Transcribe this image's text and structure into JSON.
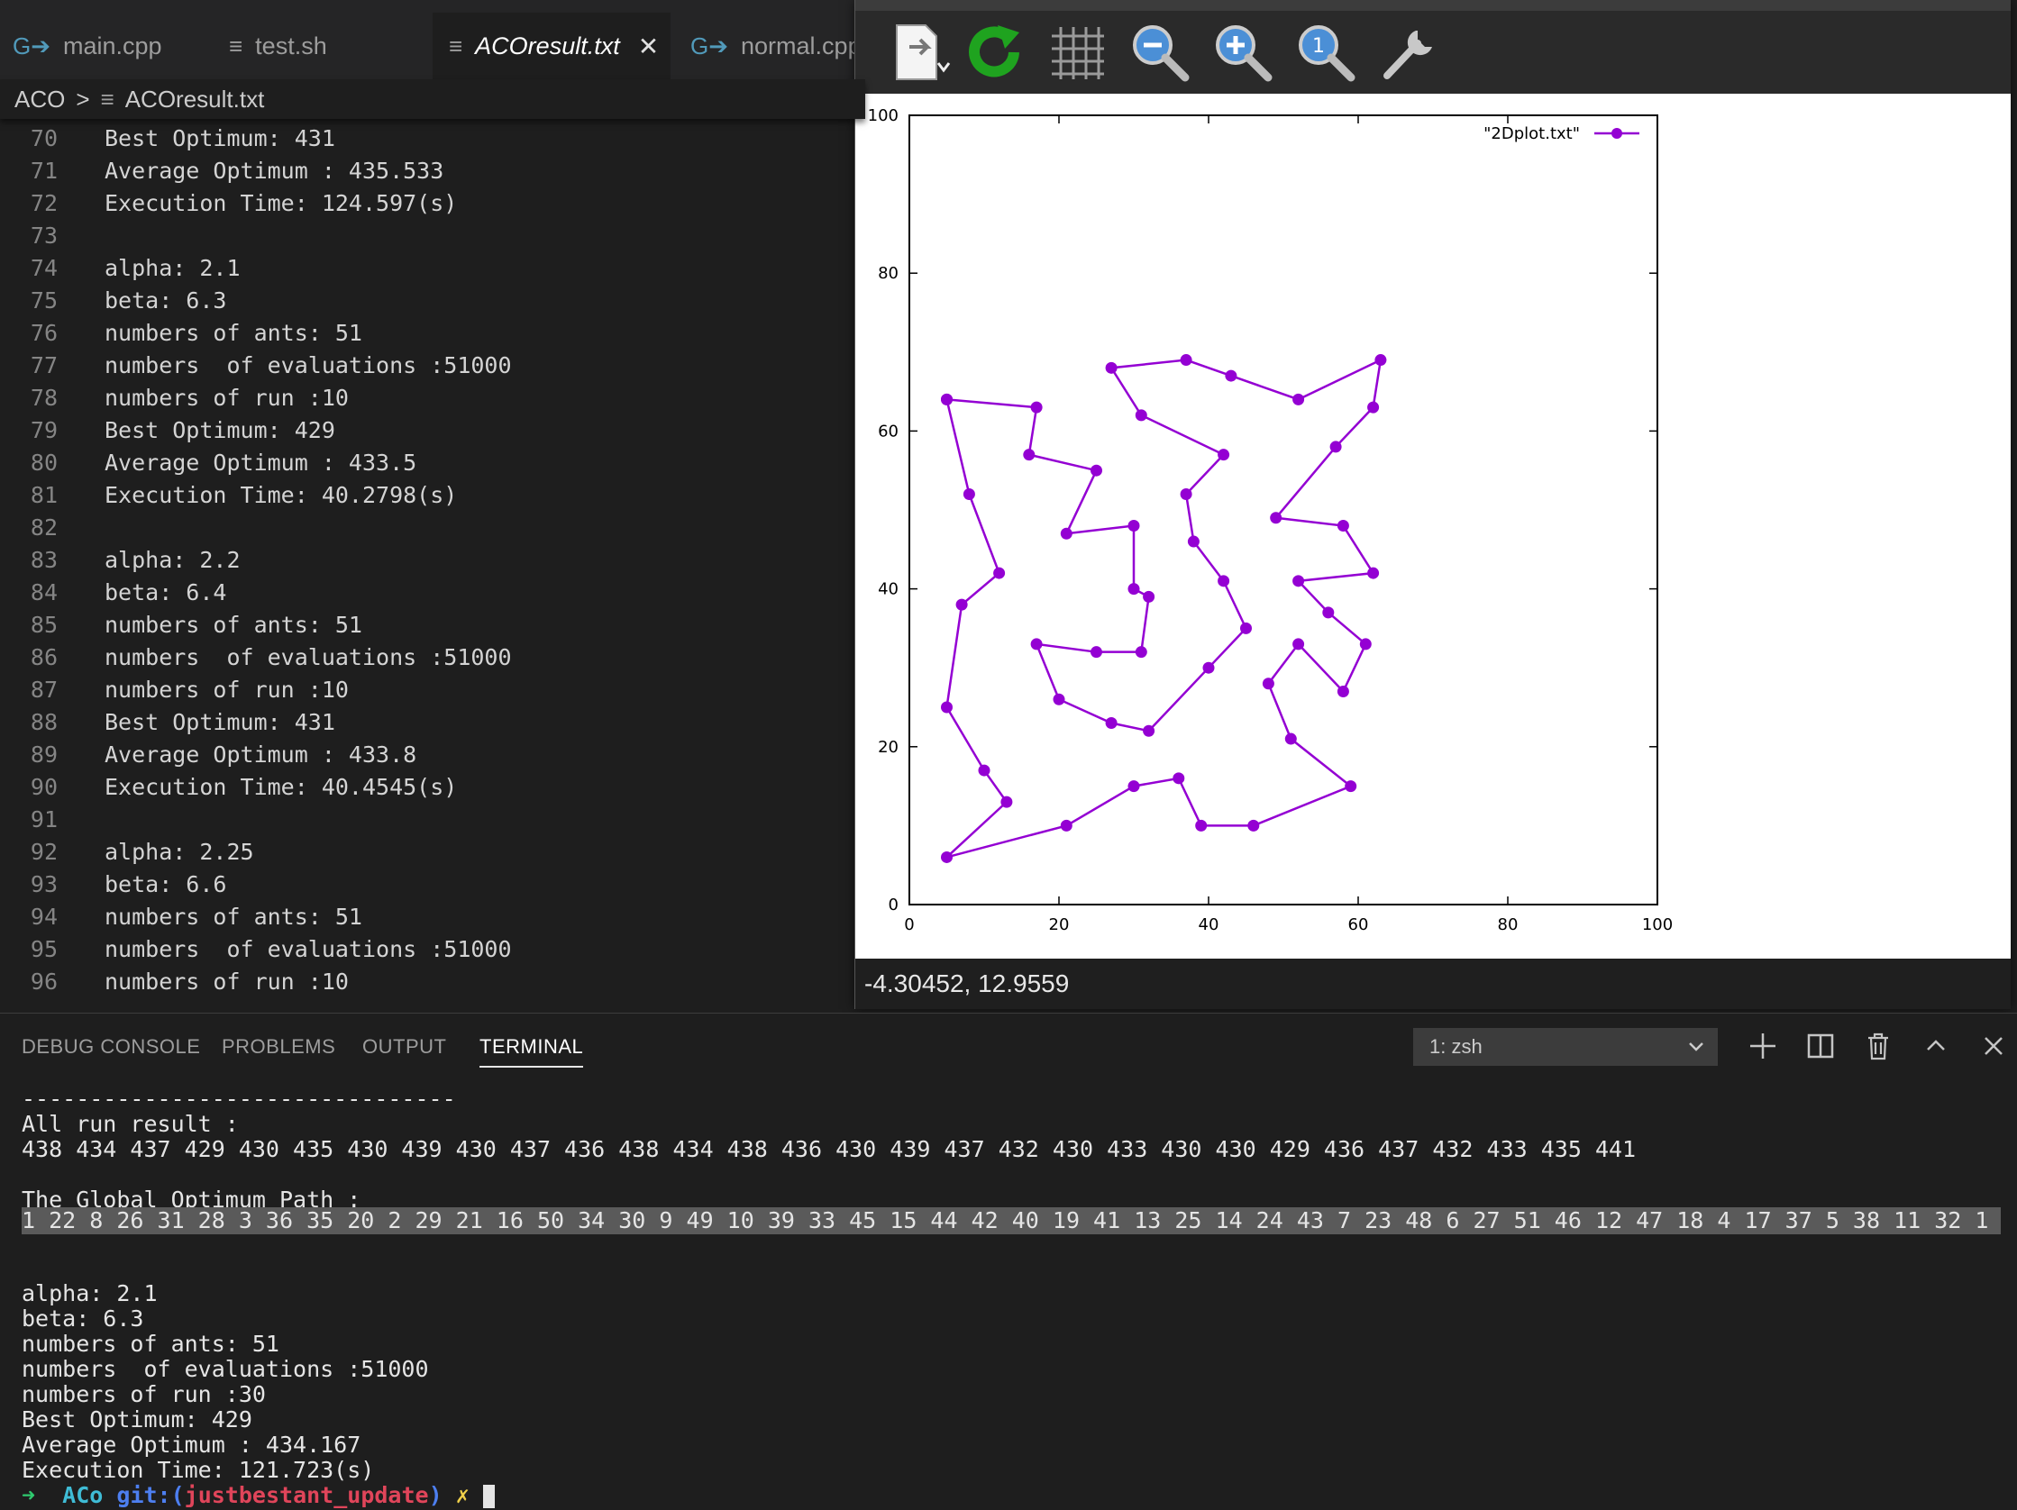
{
  "tabs": [
    {
      "label": "main.cpp",
      "icon": "cpp-file-icon",
      "active": false
    },
    {
      "label": "test.sh",
      "icon": "text-file-icon",
      "active": false
    },
    {
      "label": "ACOresult.txt",
      "icon": "text-file-icon",
      "active": true
    },
    {
      "label": "normal.cpp",
      "icon": "cpp-file-icon",
      "active": false
    }
  ],
  "breadcrumb": {
    "folder": "ACO",
    "separator": ">",
    "file": "ACOresult.txt"
  },
  "editor": {
    "lines": [
      {
        "num": "70",
        "text": "Best Optimum: 431"
      },
      {
        "num": "71",
        "text": "Average Optimum : 435.533"
      },
      {
        "num": "72",
        "text": "Execution Time: 124.597(s)"
      },
      {
        "num": "73",
        "text": ""
      },
      {
        "num": "74",
        "text": "alpha: 2.1"
      },
      {
        "num": "75",
        "text": "beta: 6.3"
      },
      {
        "num": "76",
        "text": "numbers of ants: 51"
      },
      {
        "num": "77",
        "text": "numbers  of evaluations :51000"
      },
      {
        "num": "78",
        "text": "numbers of run :10"
      },
      {
        "num": "79",
        "text": "Best Optimum: 429"
      },
      {
        "num": "80",
        "text": "Average Optimum : 433.5"
      },
      {
        "num": "81",
        "text": "Execution Time: 40.2798(s)"
      },
      {
        "num": "82",
        "text": ""
      },
      {
        "num": "83",
        "text": "alpha: 2.2"
      },
      {
        "num": "84",
        "text": "beta: 6.4"
      },
      {
        "num": "85",
        "text": "numbers of ants: 51"
      },
      {
        "num": "86",
        "text": "numbers  of evaluations :51000"
      },
      {
        "num": "87",
        "text": "numbers of run :10"
      },
      {
        "num": "88",
        "text": "Best Optimum: 431"
      },
      {
        "num": "89",
        "text": "Average Optimum : 433.8"
      },
      {
        "num": "90",
        "text": "Execution Time: 40.4545(s)"
      },
      {
        "num": "91",
        "text": ""
      },
      {
        "num": "92",
        "text": "alpha: 2.25"
      },
      {
        "num": "93",
        "text": "beta: 6.6"
      },
      {
        "num": "94",
        "text": "numbers of ants: 51"
      },
      {
        "num": "95",
        "text": "numbers  of evaluations :51000"
      },
      {
        "num": "96",
        "text": "numbers of run :10"
      }
    ]
  },
  "gnuplot": {
    "toolbar_icons": [
      "export-icon",
      "replot-icon",
      "grid-icon",
      "zoom-out-icon",
      "zoom-in-icon",
      "zoom-reset-icon",
      "settings-wrench-icon"
    ],
    "status": "-4.30452,  12.9559",
    "accent_color": "#9400d3"
  },
  "chart_data": {
    "type": "line",
    "title": "",
    "xlabel": "",
    "ylabel": "",
    "xlim": [
      0,
      100
    ],
    "ylim": [
      0,
      100
    ],
    "xticks": [
      "0",
      "20",
      "40",
      "60",
      "80",
      "100"
    ],
    "yticks": [
      "0",
      "20",
      "40",
      "60",
      "80",
      "100"
    ],
    "grid": false,
    "legend": "top-right",
    "series": [
      {
        "name": "\"2Dplot.txt\"",
        "color": "#9400d3",
        "points": [
          [
            5,
            64
          ],
          [
            17,
            63
          ],
          [
            16,
            57
          ],
          [
            25,
            55
          ],
          [
            21,
            47
          ],
          [
            30,
            48
          ],
          [
            30,
            40
          ],
          [
            32,
            39
          ],
          [
            31,
            32
          ],
          [
            25,
            32
          ],
          [
            17,
            33
          ],
          [
            20,
            26
          ],
          [
            27,
            23
          ],
          [
            32,
            22
          ],
          [
            40,
            30
          ],
          [
            45,
            35
          ],
          [
            42,
            41
          ],
          [
            38,
            46
          ],
          [
            37,
            52
          ],
          [
            42,
            57
          ],
          [
            31,
            62
          ],
          [
            27,
            68
          ],
          [
            37,
            69
          ],
          [
            43,
            67
          ],
          [
            52,
            64
          ],
          [
            63,
            69
          ],
          [
            62,
            63
          ],
          [
            57,
            58
          ],
          [
            49,
            49
          ],
          [
            58,
            48
          ],
          [
            62,
            42
          ],
          [
            52,
            41
          ],
          [
            56,
            37
          ],
          [
            61,
            33
          ],
          [
            58,
            27
          ],
          [
            52,
            33
          ],
          [
            48,
            28
          ],
          [
            51,
            21
          ],
          [
            59,
            15
          ],
          [
            46,
            10
          ],
          [
            39,
            10
          ],
          [
            36,
            16
          ],
          [
            30,
            15
          ],
          [
            21,
            10
          ],
          [
            5,
            6
          ],
          [
            13,
            13
          ],
          [
            10,
            17
          ],
          [
            5,
            25
          ],
          [
            7,
            38
          ],
          [
            12,
            42
          ],
          [
            8,
            52
          ],
          [
            5,
            64
          ]
        ]
      }
    ]
  },
  "panel": {
    "tabs": [
      {
        "label": "DEBUG CONSOLE",
        "active": false
      },
      {
        "label": "PROBLEMS",
        "active": false
      },
      {
        "label": "OUTPUT",
        "active": false
      },
      {
        "label": "TERMINAL",
        "active": true
      }
    ],
    "terminal_select": "1: zsh",
    "icons": [
      "add-terminal-icon",
      "split-terminal-icon",
      "trash-icon",
      "maximize-panel-icon",
      "close-panel-icon"
    ]
  },
  "terminal": {
    "separator": "--------------------------------",
    "all_run_label": "All run result :",
    "all_run_values": "438 434 437 429 430 435 430 439 430 437 436 438 434 438 436 430 439 437 432 430 433 430 430 429 436 437 432 433 435 441",
    "path_label": "The Global Optimum Path :",
    "path_values": "1 22 8 26 31 28 3 36 35 20 2 29 21 16 50 34 30 9 49 10 39 33 45 15 44 42 40 19 41 13 25 14 24 43 7 23 48 6 27 51 46 12 47 18 4 17 37 5 38 11 32 1",
    "summary": [
      "alpha: 2.1",
      "beta: 6.3",
      "numbers of ants: 51",
      "numbers  of evaluations :51000",
      "numbers of run :30",
      "Best Optimum: 429",
      "Average Optimum : 434.167",
      "Execution Time: 121.723(s)"
    ],
    "prompt": {
      "arrow": "➜",
      "dir": "ACo",
      "git": "git:(",
      "branch": "justbestant_update",
      "git_close": ")",
      "dirty": "✗"
    }
  }
}
